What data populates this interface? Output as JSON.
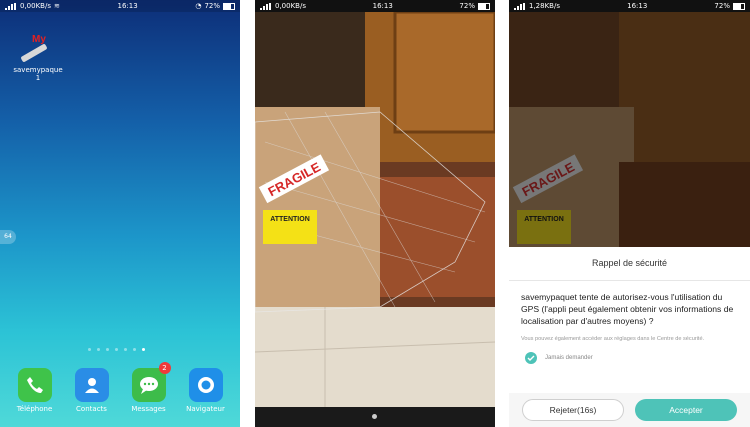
{
  "status_left": {
    "speed": "0,00KB/s",
    "time": "16:13"
  },
  "status_mid": {
    "speed": "0,00KB/s",
    "time": "16:13"
  },
  "status_right": {
    "speed": "1,28KB/s",
    "time": "16:13"
  },
  "battery": "72%",
  "home": {
    "app_badge": "My",
    "app_label": "savemypaque\n1",
    "side_tab": "64",
    "dock": [
      {
        "label": "Téléphone",
        "icon": "phone-icon",
        "color": "#3fc34a"
      },
      {
        "label": "Contacts",
        "icon": "contact-icon",
        "color": "#2a8de6"
      },
      {
        "label": "Messages",
        "icon": "message-icon",
        "color": "#3dbc4a",
        "badge": "2"
      },
      {
        "label": "Navigateur",
        "icon": "browser-icon",
        "color": "#1f8fe8"
      }
    ]
  },
  "camera": {
    "sticker_fragile": "FRAGILE",
    "sticker_attention": "ATTENTION"
  },
  "dialog": {
    "title": "Rappel de sécurité",
    "message": "savemypaquet tente de autorisez-vous l'utilisation du GPS (l'appli peut également obtenir vos informations de localisation par d'autres moyens) ?",
    "note": "Vous pouvez également accéder aux réglages dans le Centre de sécurité.",
    "checkbox_label": "Jamais demander",
    "reject_label": "Rejeter(16s)",
    "accept_label": "Accepter"
  }
}
